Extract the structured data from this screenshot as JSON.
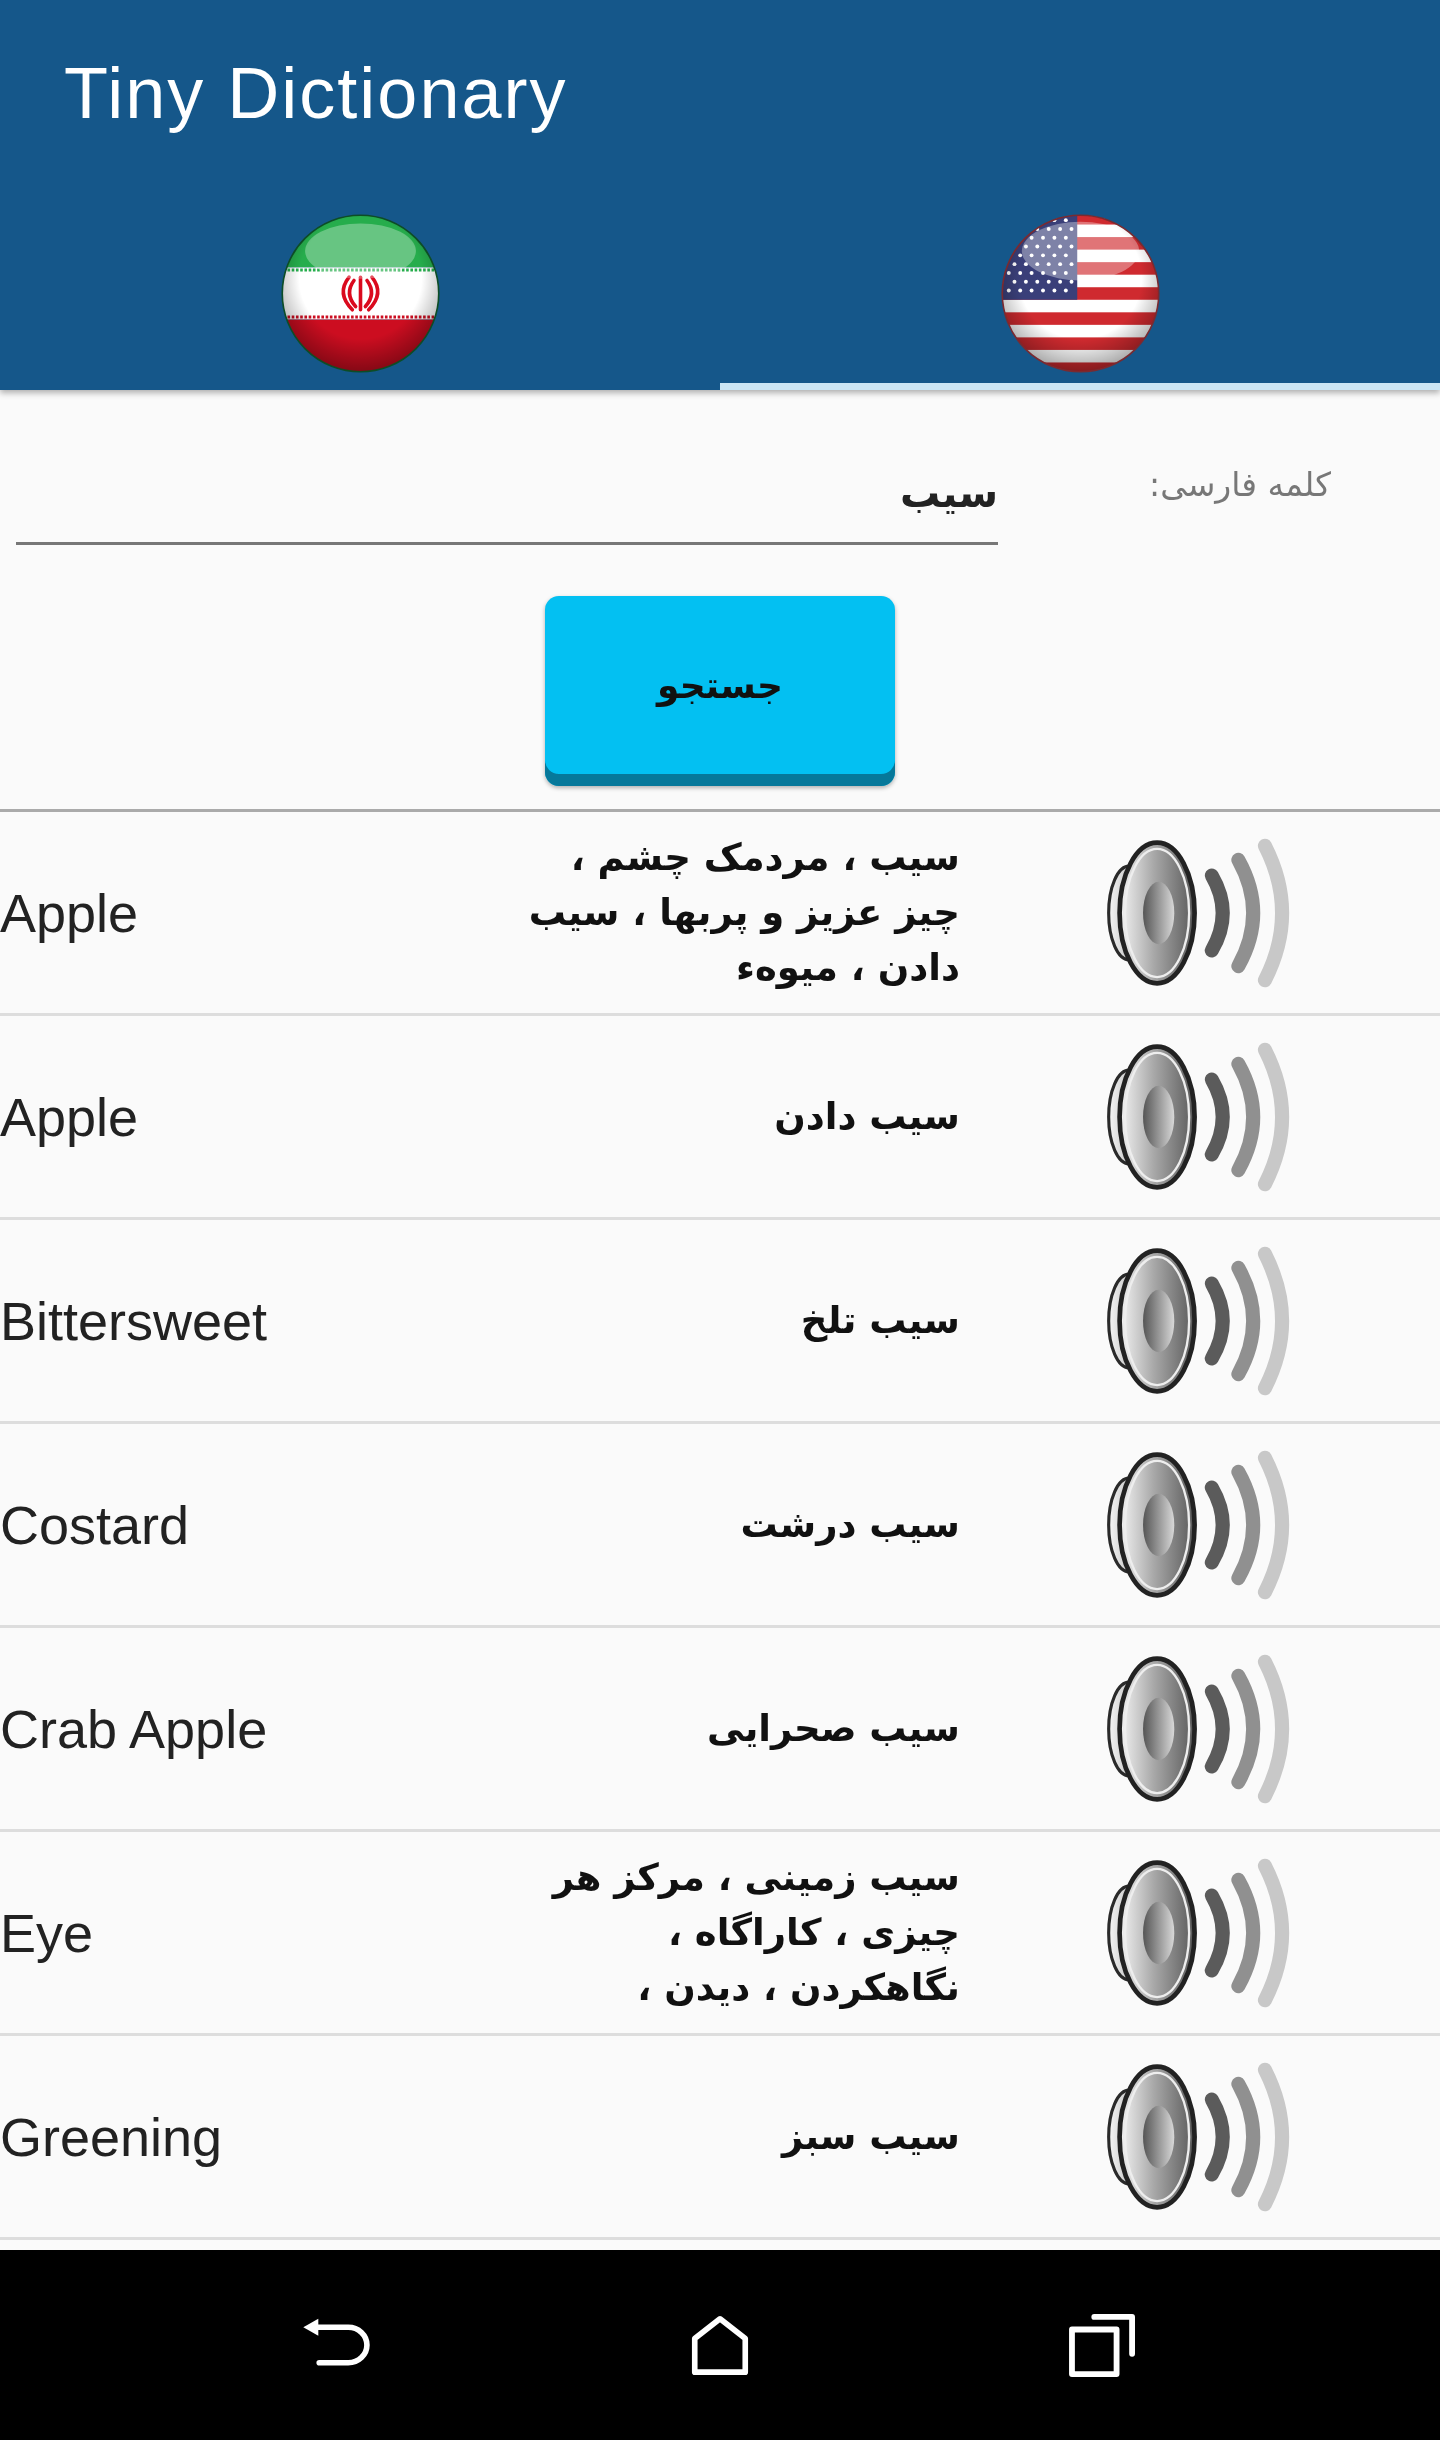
{
  "app_bar": {
    "title": "Tiny Dictionary"
  },
  "tabs": [
    {
      "kind": "persian",
      "selected": false
    },
    {
      "kind": "english",
      "selected": true
    }
  ],
  "search": {
    "label": "کلمه فارسی:",
    "value": "سیب",
    "button": "جستجو"
  },
  "results": [
    {
      "english": "Apple",
      "persian": "سیب ، مردمک چشم ، چیز عزیز و پربها ، سیب دادن ، میوهء"
    },
    {
      "english": "Apple",
      "persian": "سیب دادن"
    },
    {
      "english": "Bittersweet",
      "persian": "سیب تلخ"
    },
    {
      "english": "Costard",
      "persian": "سیب درشت"
    },
    {
      "english": "Crab Apple",
      "persian": "سیب صحرایی"
    },
    {
      "english": "Eye",
      "persian": "سیب زمینی ، مرکز هر چیزی ، کاراگاه ، نگاهکردن ، دیدن ،"
    },
    {
      "english": "Greening",
      "persian": "سیب سبز"
    }
  ],
  "nav_bar": {
    "buttons": [
      {
        "kind": "back"
      },
      {
        "kind": "home"
      },
      {
        "kind": "recents"
      }
    ]
  }
}
